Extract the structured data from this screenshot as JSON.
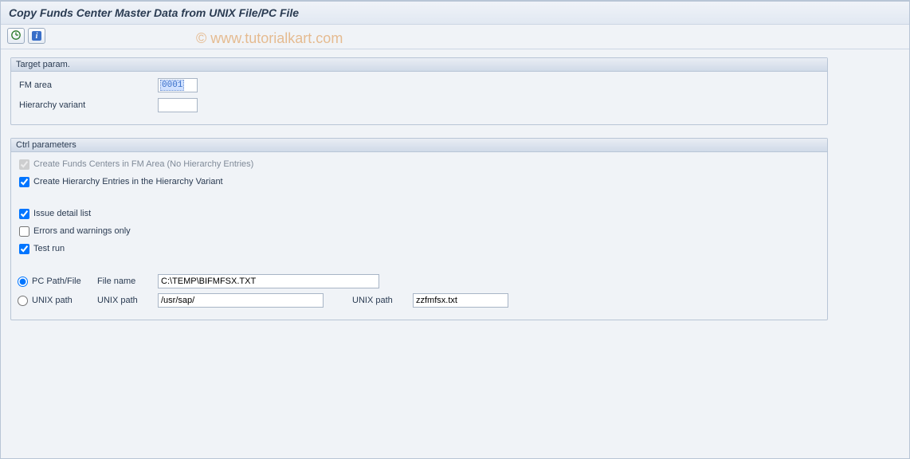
{
  "title": "Copy Funds Center Master Data from UNIX File/PC File",
  "watermark": "© www.tutorialkart.com",
  "toolbar": {
    "execute": "execute",
    "info": "i"
  },
  "groups": {
    "target": {
      "header": "Target param.",
      "fm_area_label": "FM area",
      "fm_area_value": "0001",
      "hierarchy_label": "Hierarchy variant",
      "hierarchy_value": ""
    },
    "ctrl": {
      "header": "Ctrl parameters",
      "create_fc_label": "Create Funds Centers in FM Area (No Hierarchy Entries)",
      "create_hier_label": "Create Hierarchy Entries in the Hierarchy Variant",
      "issue_detail_label": "Issue detail list",
      "errors_only_label": "Errors and warnings only",
      "test_run_label": "Test run",
      "pc_radio_label": "PC Path/File",
      "unix_radio_label": "UNIX path",
      "file_name_label": "File name",
      "file_name_value": "C:\\TEMP\\BIFMFSX.TXT",
      "unix_path_label_1": "UNIX path",
      "unix_path_value_1": "/usr/sap/",
      "unix_path_label_2": "UNIX path",
      "unix_path_value_2": "zzfmfsx.txt"
    }
  }
}
